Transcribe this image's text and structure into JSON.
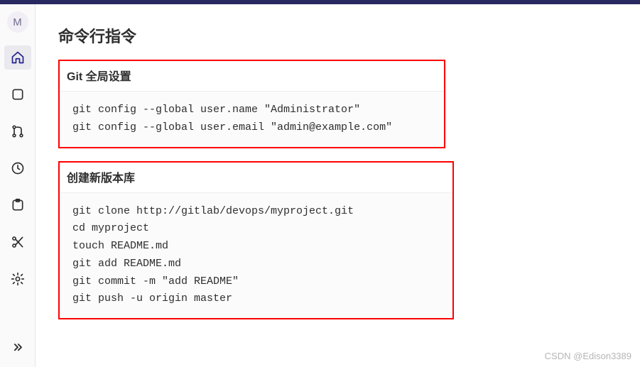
{
  "avatar_letter": "M",
  "page_title": "命令行指令",
  "sections": [
    {
      "title": "Git 全局设置",
      "code": "git config --global user.name \"Administrator\"\ngit config --global user.email \"admin@example.com\""
    },
    {
      "title": "创建新版本库",
      "code": "git clone http://gitlab/devops/myproject.git\ncd myproject\ntouch README.md\ngit add README.md\ngit commit -m \"add README\"\ngit push -u origin master"
    }
  ],
  "watermark": "CSDN @Edison3389"
}
